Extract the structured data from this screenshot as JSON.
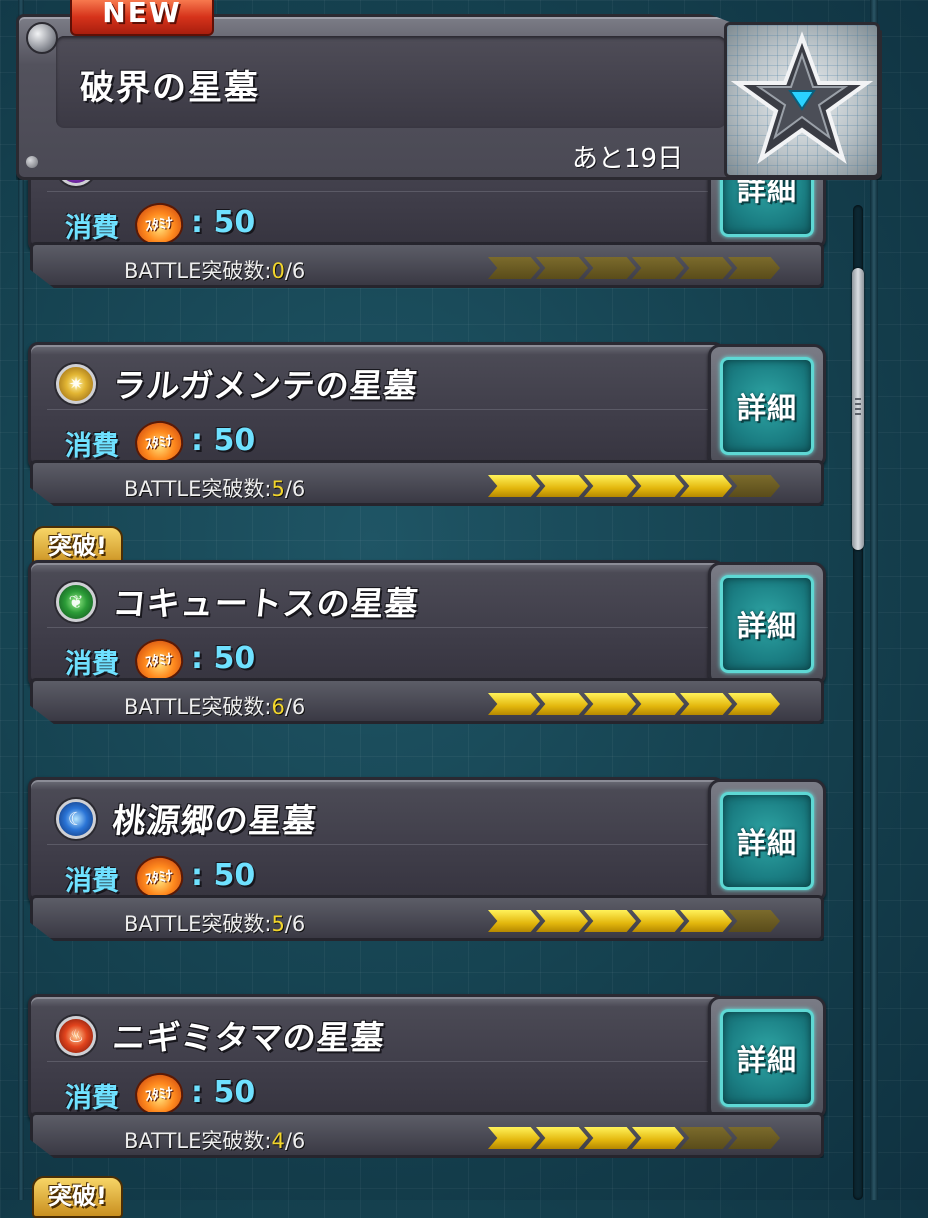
{
  "event": {
    "new_label": "NEW",
    "title": "破界の星墓",
    "remaining": "あと19日",
    "emblem_icon": "star-tomb-emblem-icon"
  },
  "common": {
    "cost_label": "消費",
    "stamina_label": "ｽﾀﾐﾅ",
    "detail_label": "詳細",
    "breakthrough_label": "突破!",
    "progress_label": "BATTLE突破数:",
    "progress_total": "/6"
  },
  "quests": [
    {
      "title": "",
      "element": "dark",
      "element_icon": "dark-element-icon",
      "cost": ": 50",
      "progress": "0",
      "cleared": 0,
      "total": 6
    },
    {
      "title": "ラルガメンテの星墓",
      "element": "light",
      "element_icon": "light-element-icon",
      "cost": ": 50",
      "progress": "5",
      "cleared": 5,
      "total": 6
    },
    {
      "title": "コキュートスの星墓",
      "element": "wood",
      "element_icon": "wood-element-icon",
      "cost": ": 50",
      "progress": "6",
      "cleared": 6,
      "total": 6,
      "breakthrough": true
    },
    {
      "title": "桃源郷の星墓",
      "element": "water",
      "element_icon": "water-element-icon",
      "cost": ": 50",
      "progress": "5",
      "cleared": 5,
      "total": 6
    },
    {
      "title": "ニギミタマの星墓",
      "element": "fire",
      "element_icon": "fire-element-icon",
      "cost": ": 50",
      "progress": "4",
      "cleared": 4,
      "total": 6
    }
  ]
}
